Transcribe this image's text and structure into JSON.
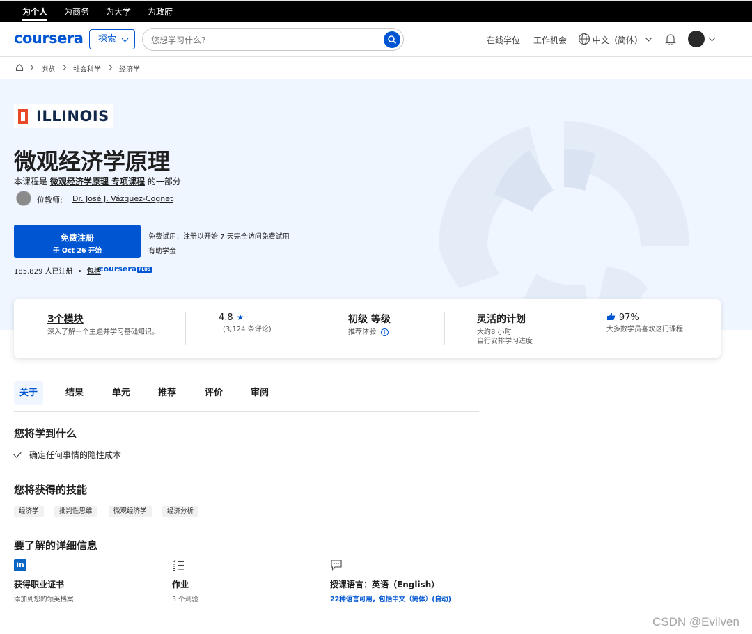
{
  "topbar": {
    "segments": [
      "为个人",
      "为商务",
      "为大学",
      "为政府"
    ]
  },
  "header": {
    "logo": "coursera",
    "explore_label": "探索",
    "search_placeholder": "您想学习什么?",
    "links": [
      "在线学位",
      "工作机会"
    ],
    "language": "中文（简体）"
  },
  "breadcrumb": [
    "浏览",
    "社会科学",
    "经济学"
  ],
  "course": {
    "university": "ILLINOIS",
    "title": "微观经济学原理",
    "part_of_prefix": "本课程是",
    "part_of_link": "微观经济学原理 专项课程",
    "part_of_suffix": "的一部分",
    "instructor_label": "位教师:",
    "instructor_name": "Dr. José J. Vázquez-Cognet"
  },
  "enroll": {
    "button_line1": "免费注册",
    "button_line2": "于 Oct 26 开始",
    "trial_text": "免费试用：注册以开始 7 天完全访问免费试用",
    "aid_text": "有助学金",
    "enrolled_count": "185,829 人已注册",
    "bullet": "•",
    "included_label": "包括",
    "plus_logo": "coursera",
    "plus_badge": "PLUS"
  },
  "stats": [
    {
      "title": "3个模块",
      "sub": "深入了解一个主题并学习基础知识。"
    },
    {
      "title": "4.8",
      "sub": "(3,124 条评论)"
    },
    {
      "title": "初级 等级",
      "sub": "推荐体验"
    },
    {
      "title": "灵活的计划",
      "sub": "大约8 小时",
      "sub2": "自行安排学习进度"
    },
    {
      "title": "97%",
      "sub": "大多数学员喜欢这门课程"
    }
  ],
  "tabs": [
    "关于",
    "结果",
    "单元",
    "推荐",
    "评价",
    "审阅"
  ],
  "learn": {
    "heading": "您将学到什么",
    "items": [
      "确定任何事情的隐性成本"
    ]
  },
  "skills": {
    "heading": "您将获得的技能",
    "items": [
      "经济学",
      "批判性思维",
      "微观经济学",
      "经济分析"
    ]
  },
  "details": {
    "heading": "要了解的详细信息",
    "items": [
      {
        "title": "获得职业证书",
        "sub": "添加到您的领英档案"
      },
      {
        "title": "作业",
        "sub": "3 个测验"
      },
      {
        "title": "授课语言：英语（English）",
        "sub": "22种语言可用，包括中文（简体）(自动)"
      }
    ]
  },
  "watermark": "CSDN @Evilven",
  "colors": {
    "brand": "#0056d2",
    "hero_bg": "#f0f6ff",
    "illinois_orange": "#e84a27",
    "illinois_navy": "#13294b"
  }
}
